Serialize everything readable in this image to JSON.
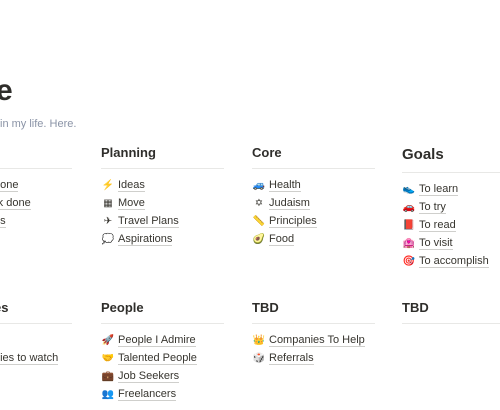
{
  "page": {
    "title": "e",
    "subtitle": "in my life. Here."
  },
  "row1": {
    "col0": {
      "items": [
        "done",
        "rk done",
        "es"
      ]
    },
    "planning": {
      "heading": "Planning",
      "items": [
        {
          "icon": "⚡",
          "icon_name": "lightning-icon",
          "label": "Ideas"
        },
        {
          "icon": "▦",
          "icon_name": "building-icon",
          "label": "Move"
        },
        {
          "icon": "✈",
          "icon_name": "airplane-icon",
          "label": "Travel Plans"
        },
        {
          "icon": "💭",
          "icon_name": "thought-bubble-icon",
          "label": "Aspirations"
        }
      ]
    },
    "core": {
      "heading": "Core",
      "items": [
        {
          "icon": "🚙",
          "icon_name": "car-icon",
          "label": "Health"
        },
        {
          "icon": "✡",
          "icon_name": "star-of-david-icon",
          "label": "Judaism"
        },
        {
          "icon": "📏",
          "icon_name": "ruler-icon",
          "label": "Principles"
        },
        {
          "icon": "🥑",
          "icon_name": "avocado-icon",
          "label": "Food"
        }
      ]
    },
    "goals": {
      "heading": "Goals",
      "items": [
        {
          "icon": "👟",
          "icon_name": "shoe-icon",
          "label": "To learn"
        },
        {
          "icon": "🚗",
          "icon_name": "red-car-icon",
          "label": "To try"
        },
        {
          "icon": "📕",
          "icon_name": "red-book-icon",
          "label": "To read"
        },
        {
          "icon": "🏩",
          "icon_name": "hotel-icon",
          "label": "To visit"
        },
        {
          "icon": "🎯",
          "icon_name": "target-icon",
          "label": "To accomplish"
        }
      ]
    }
  },
  "row2": {
    "col0": {
      "heading": "es",
      "items": [
        "nies to watch",
        "e"
      ]
    },
    "people": {
      "heading": "People",
      "items": [
        {
          "icon": "🚀",
          "icon_name": "rocket-icon",
          "label": "People I Admire"
        },
        {
          "icon": "🤝",
          "icon_name": "handshake-icon",
          "label": "Talented People"
        },
        {
          "icon": "💼",
          "icon_name": "briefcase-icon",
          "label": "Job Seekers"
        },
        {
          "icon": "👥",
          "icon_name": "people-icon",
          "label": "Freelancers"
        }
      ]
    },
    "tbd1": {
      "heading": "TBD",
      "items": [
        {
          "icon": "👑",
          "icon_name": "crown-icon",
          "label": "Companies To Help"
        },
        {
          "icon": "🎲",
          "icon_name": "dice-icon",
          "label": "Referrals"
        }
      ]
    },
    "tbd2": {
      "heading": "TBD"
    }
  }
}
